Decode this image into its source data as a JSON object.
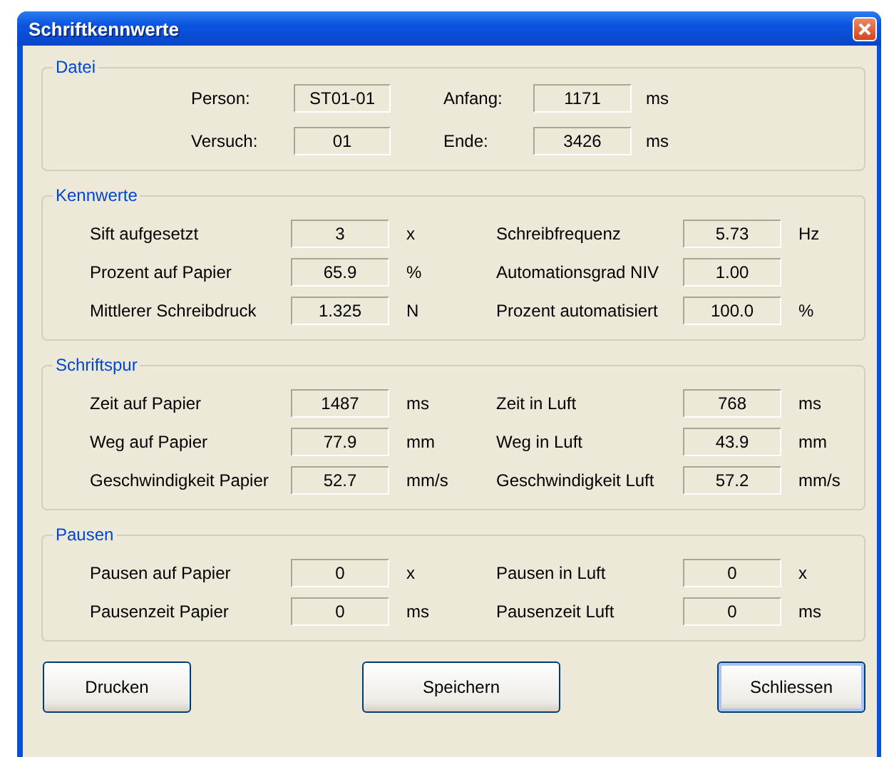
{
  "window": {
    "title": "Schriftkennwerte"
  },
  "groups": [
    {
      "title": "Datei",
      "kind": "file",
      "items": [
        {
          "label": "Person:",
          "value": "ST01-01"
        },
        {
          "label": "Anfang:",
          "value": "1171",
          "unit": "ms"
        },
        {
          "label": "Versuch:",
          "value": "01"
        },
        {
          "label": "Ende:",
          "value": "3426",
          "unit": "ms"
        }
      ]
    },
    {
      "title": "Kennwerte",
      "kind": "metrics",
      "items": [
        {
          "label": "Sift aufgesetzt",
          "value": "3",
          "unit": "x"
        },
        {
          "label": "Schreibfrequenz",
          "value": "5.73",
          "unit": "Hz"
        },
        {
          "label": "Prozent auf Papier",
          "value": "65.9",
          "unit": "%"
        },
        {
          "label": "Automationsgrad NIV",
          "value": "1.00"
        },
        {
          "label": "Mittlerer Schreibdruck",
          "value": "1.325",
          "unit": "N"
        },
        {
          "label": "Prozent automatisiert",
          "value": "100.0",
          "unit": "%"
        }
      ]
    },
    {
      "title": "Schriftspur",
      "kind": "metrics",
      "items": [
        {
          "label": "Zeit auf Papier",
          "value": "1487",
          "unit": "ms"
        },
        {
          "label": "Zeit in Luft",
          "value": "768",
          "unit": "ms"
        },
        {
          "label": "Weg auf Papier",
          "value": "77.9",
          "unit": "mm"
        },
        {
          "label": "Weg in Luft",
          "value": "43.9",
          "unit": "mm"
        },
        {
          "label": "Geschwindigkeit Papier",
          "value": "52.7",
          "unit": "mm/s"
        },
        {
          "label": "Geschwindigkeit Luft",
          "value": "57.2",
          "unit": "mm/s"
        }
      ]
    },
    {
      "title": "Pausen",
      "kind": "metrics",
      "items": [
        {
          "label": "Pausen auf Papier",
          "value": "0",
          "unit": "x"
        },
        {
          "label": "Pausen in Luft",
          "value": "0",
          "unit": "x"
        },
        {
          "label": "Pausenzeit Papier",
          "value": "0",
          "unit": "ms"
        },
        {
          "label": "Pausenzeit Luft",
          "value": "0",
          "unit": "ms"
        }
      ]
    }
  ],
  "buttons": [
    {
      "label": "Drucken",
      "kind": "plain"
    },
    {
      "label": "Speichern",
      "kind": "plain"
    },
    {
      "label": "Schliessen",
      "kind": "default"
    }
  ]
}
